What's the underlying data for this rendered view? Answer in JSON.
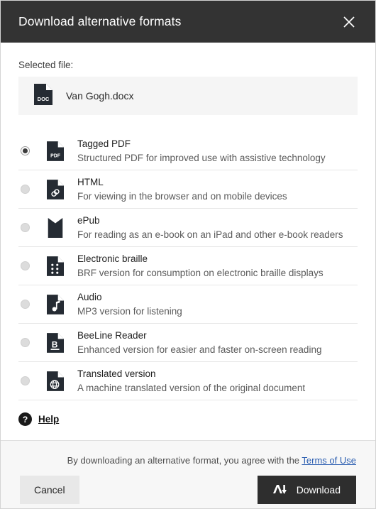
{
  "header": {
    "title": "Download alternative formats",
    "close_icon": "close-icon"
  },
  "body": {
    "selected_file_label": "Selected file:",
    "file": {
      "name": "Van Gogh.docx",
      "icon": "doc-file-icon",
      "icon_text": "DOC"
    }
  },
  "options": [
    {
      "id": "tagged-pdf",
      "title": "Tagged PDF",
      "description": "Structured PDF for improved use with assistive technology",
      "icon": "pdf-file-icon",
      "icon_text": "PDF",
      "selected": true
    },
    {
      "id": "html",
      "title": "HTML",
      "description": "For viewing in the browser and on mobile devices",
      "icon": "link-file-icon",
      "selected": false
    },
    {
      "id": "epub",
      "title": "ePub",
      "description": "For reading as an e-book on an iPad and other e-book readers",
      "icon": "bookmark-icon",
      "selected": false
    },
    {
      "id": "electronic-braille",
      "title": "Electronic braille",
      "description": "BRF version for consumption on electronic braille displays",
      "icon": "braille-file-icon",
      "selected": false
    },
    {
      "id": "audio",
      "title": "Audio",
      "description": "MP3 version for listening",
      "icon": "music-note-file-icon",
      "selected": false
    },
    {
      "id": "beeline-reader",
      "title": "BeeLine Reader",
      "description": "Enhanced version for easier and faster on-screen reading",
      "icon": "beeline-file-icon",
      "icon_text": "B",
      "selected": false
    },
    {
      "id": "translated-version",
      "title": "Translated version",
      "description": "A machine translated version of the original document",
      "icon": "globe-file-icon",
      "selected": false
    }
  ],
  "help": {
    "icon": "question-mark-circle-icon",
    "label": "Help"
  },
  "footer": {
    "terms_prefix": "By downloading an alternative format, you agree with the ",
    "terms_link": "Terms of Use",
    "cancel_label": "Cancel",
    "download_label": "Download",
    "download_icon": "font-download-icon"
  },
  "colors": {
    "header_bg": "#333333",
    "accent_link": "#2a5db0",
    "download_btn_bg": "#2e2e2e",
    "cancel_btn_bg": "#e8e8e8",
    "icon_dark": "#252b33"
  }
}
